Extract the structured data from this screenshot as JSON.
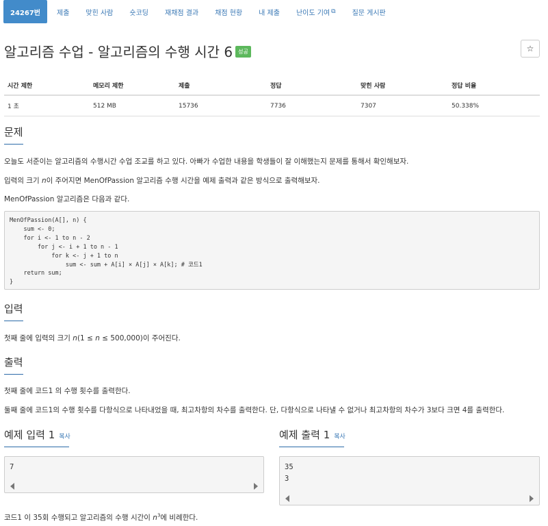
{
  "nav": {
    "problem_id": "24267번",
    "submit": "제출",
    "solved_users": "맞힌 사람",
    "shortest": "숏코딩",
    "rejudge": "재채점 결과",
    "judge_status": "채점 현황",
    "my_submissions": "내 제출",
    "difficulty": "난이도 기여",
    "qna": "질문 게시판"
  },
  "title": {
    "text": "알고리즘 수업 - 알고리즘의 수행 시간 6",
    "badge": "성공",
    "star": "☆"
  },
  "stats": {
    "headers": [
      "시간 제한",
      "메모리 제한",
      "제출",
      "정답",
      "맞힌 사람",
      "정답 비율"
    ],
    "values": [
      "1 초",
      "512 MB",
      "15736",
      "7736",
      "7307",
      "50.338%"
    ]
  },
  "problem": {
    "heading": "문제",
    "p1": "오늘도 서준이는 알고리즘의 수행시간 수업 조교를 하고 있다. 아빠가 수업한 내용을 학생들이 잘 이해했는지 문제를 통해서 확인해보자.",
    "p2_pre": "입력의 크기 ",
    "p2_var": "n",
    "p2_post": "이 주어지면 MenOfPassion 알고리즘 수행 시간을 예제 출력과 같은 방식으로 출력해보자.",
    "p3": "MenOfPassion 알고리즘은 다음과 같다.",
    "code": "MenOfPassion(A[], n) {\n    sum <- 0;\n    for i <- 1 to n - 2\n        for j <- i + 1 to n - 1\n            for k <- j + 1 to n\n                sum <- sum + A[i] × A[j] × A[k]; # 코드1\n    return sum;\n}"
  },
  "input": {
    "heading": "입력",
    "p_pre": "첫째 줄에 입력의 크기 ",
    "p_var": "n",
    "p_mid": "(1 ≤ ",
    "p_var2": "n",
    "p_post": " ≤ 500,000)이 주어진다."
  },
  "output": {
    "heading": "출력",
    "p1": "첫째 줄에 코드1 의 수행 횟수를 출력한다.",
    "p2": "둘째 줄에 코드1의 수행 횟수를 다항식으로 나타내었을 때, 최고차항의 차수를 출력한다. 단, 다항식으로 나타낼 수 없거나 최고차항의 차수가 3보다 크면 4를 출력한다."
  },
  "sample_input": {
    "heading": "예제 입력 1",
    "copy": "복사",
    "content": "7"
  },
  "sample_output": {
    "heading": "예제 출력 1",
    "copy": "복사",
    "content": "35\n3"
  },
  "hint": {
    "pre": "코드1 이 35회 수행되고 알고리즘의 수행 시간이 ",
    "var": "n",
    "sup": "3",
    "post": "에 비례한다."
  }
}
